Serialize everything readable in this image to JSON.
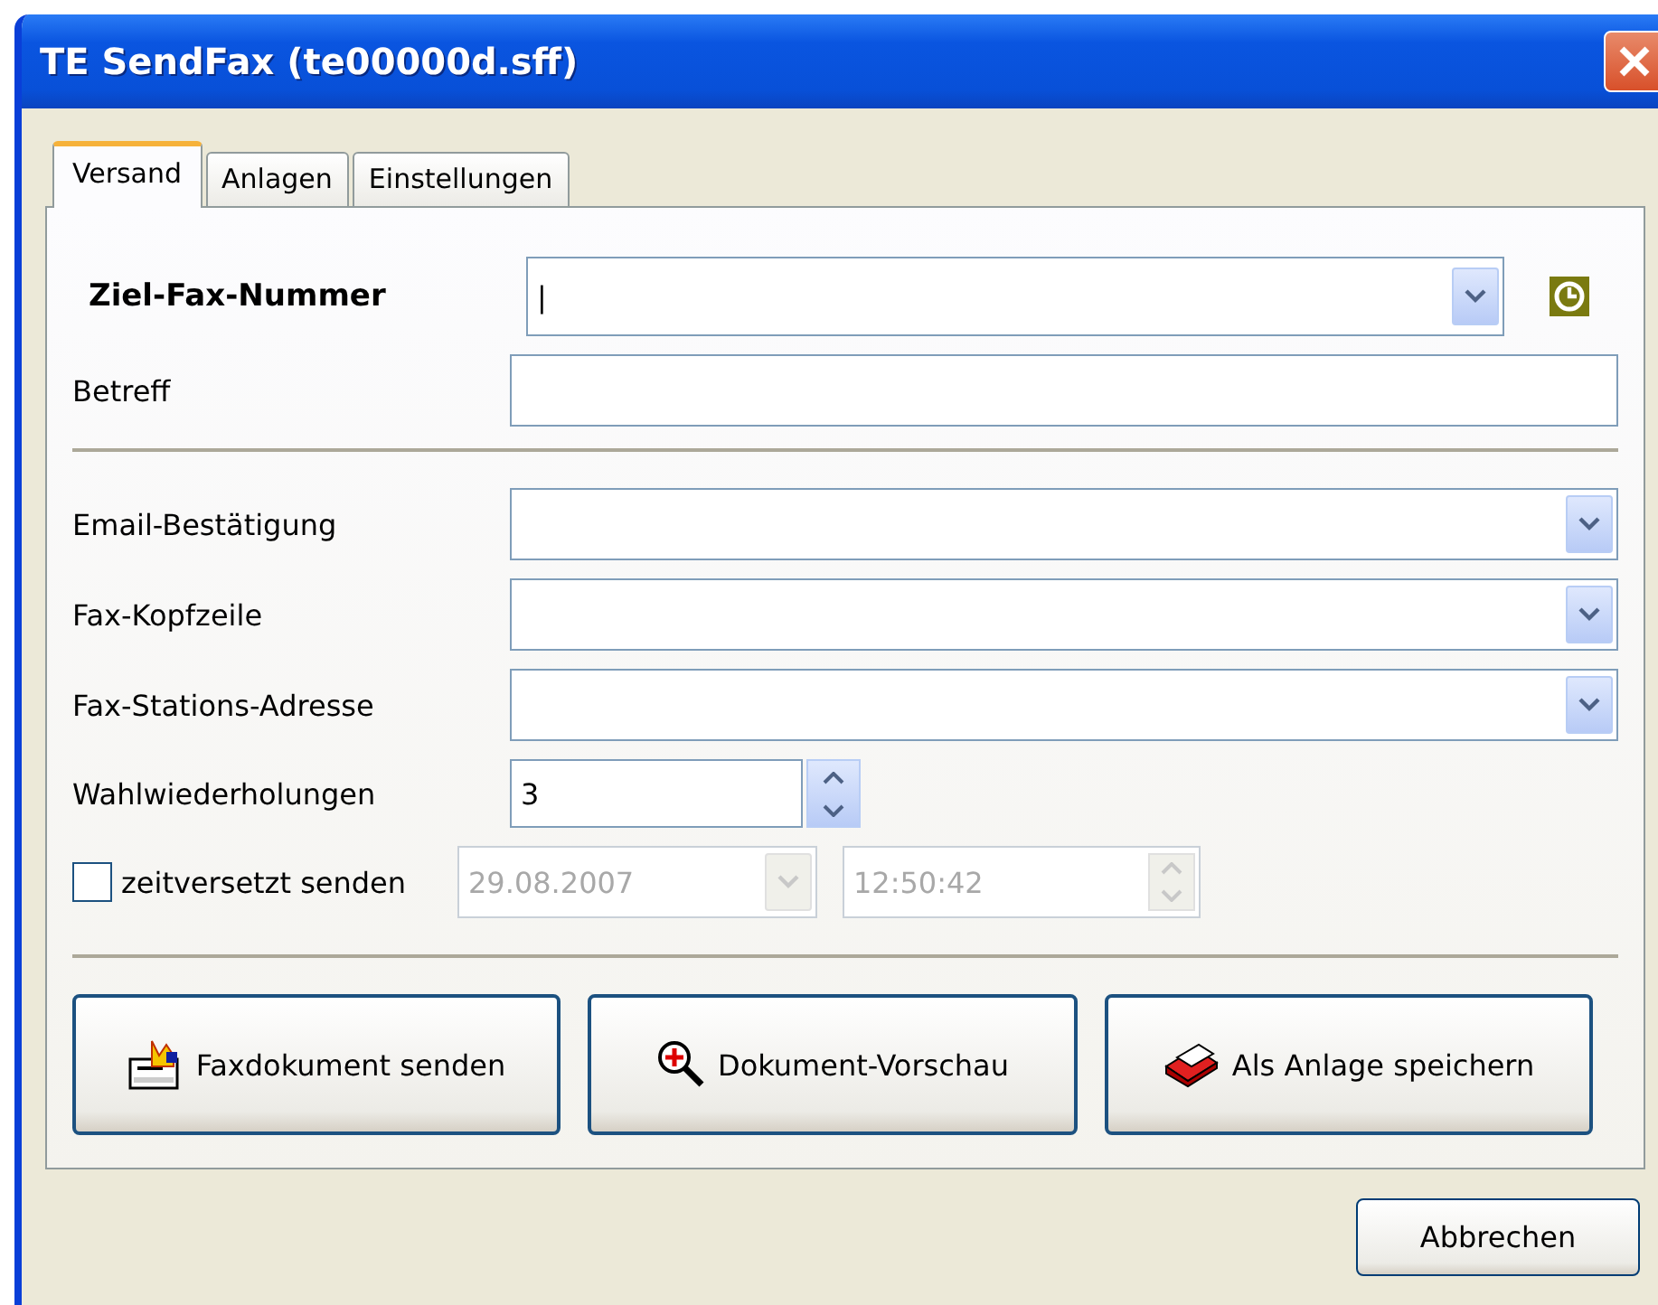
{
  "window": {
    "title": "TE SendFax (te00000d.sff)"
  },
  "tabs": [
    {
      "label": "Versand",
      "selected": true
    },
    {
      "label": "Anlagen",
      "selected": false
    },
    {
      "label": "Einstellungen",
      "selected": false
    }
  ],
  "recipient": {
    "label": "Ziel-Fax-Nummer",
    "value": "|"
  },
  "subject": {
    "label": "Betreff"
  },
  "options": [
    {
      "label": "Email-Bestätigung",
      "kind": "combo"
    },
    {
      "label": "Fax-Kopfzeile",
      "kind": "combo"
    },
    {
      "label": "Fax-Stations-Adresse",
      "kind": "combo"
    },
    {
      "label": "Wahlwiederholungen",
      "kind": "spin",
      "value": "3"
    }
  ],
  "delayed": {
    "label": "zeitversetzt senden",
    "checked": false,
    "date": "29.08.2007",
    "time": "12:50:42"
  },
  "actions": [
    {
      "label": "Faxdokument senden",
      "kind": "send"
    },
    {
      "label": "Dokument-Vorschau",
      "kind": "preview"
    },
    {
      "label": "Als Anlage speichern",
      "kind": "save"
    }
  ],
  "cancel": "Abbrechen"
}
